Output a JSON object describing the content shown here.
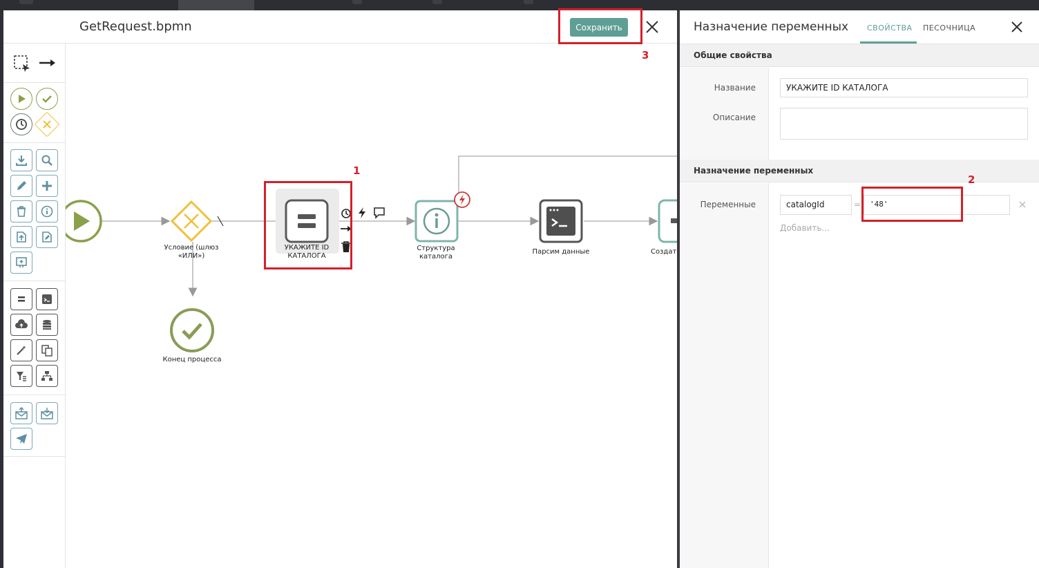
{
  "editor": {
    "title": "GetRequest.bpmn",
    "save_label": "Сохранить"
  },
  "diagram": {
    "condition_label_1": "Условие (шлюз",
    "condition_label_2": "«ИЛИ»)",
    "task_label_1": "УКАЖИТЕ ID",
    "task_label_2": "КАТАЛОГА",
    "info_label_1": "Структура",
    "info_label_2": "каталога",
    "parse_label": "Парсим данные",
    "create_label": "Создат",
    "end_label": "Конец процесса"
  },
  "annotations": {
    "n1": "1",
    "n2": "2",
    "n3": "3"
  },
  "panel": {
    "title": "Назначение переменных",
    "tabs": [
      "СВОЙСТВА",
      "ПЕСОЧНИЦА"
    ],
    "general_section": "Общие свойства",
    "name_label": "Название",
    "name_value": "УКАЖИТЕ ID КАТАЛОГА",
    "description_label": "Описание",
    "description_value": "",
    "vars_section": "Назначение переменных",
    "vars_label": "Переменные",
    "var_name": "catalogId",
    "var_eq": "=",
    "var_value": "'48'",
    "add_label": "Добавить..."
  },
  "colors": {
    "accent": "#5f9e94",
    "highlight": "#d3202a",
    "start_event": "#8aa04a",
    "gateway": "#f0c03a"
  }
}
